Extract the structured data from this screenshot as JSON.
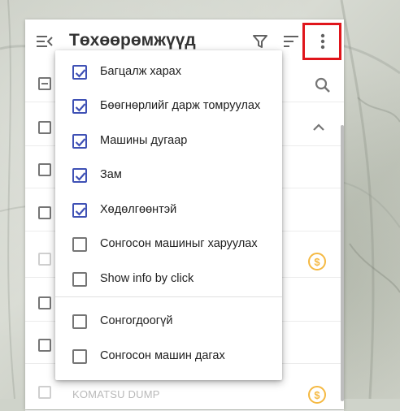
{
  "panel": {
    "title": "Төхөөрөмжүүд",
    "vehicle_partial_label": "KOMATSU DUMP"
  },
  "menu": {
    "items": [
      {
        "label": "Багцалж харах",
        "checked": true
      },
      {
        "label": "Бөөгнөрлийг дарж томруулах",
        "checked": true
      },
      {
        "label": "Машины дугаар",
        "checked": true
      },
      {
        "label": "Зам",
        "checked": true
      },
      {
        "label": "Хөдөлгөөнтэй",
        "checked": true
      },
      {
        "label": "Сонгосон машиныг харуулах",
        "checked": false
      },
      {
        "label": "Show info by click",
        "checked": false
      },
      {
        "label": "Сонгогдоогүй",
        "checked": false
      },
      {
        "label": "Сонгосон машин дагах",
        "checked": false
      }
    ]
  },
  "icons": {
    "collapse": "collapse-list-icon",
    "filter": "filter-icon",
    "sort": "sort-icon",
    "more": "more-vert-icon",
    "search": "search-icon",
    "chevron": "chevron-up-icon",
    "coin": "dollar-coin-icon"
  },
  "colors": {
    "accent": "#3f51b5",
    "highlight": "#e0151b",
    "coin": "#f5b942"
  }
}
